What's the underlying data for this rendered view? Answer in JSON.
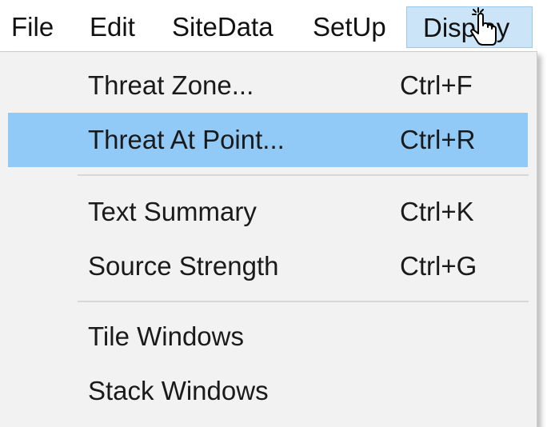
{
  "menubar": {
    "items": [
      {
        "label": "File"
      },
      {
        "label": "Edit"
      },
      {
        "label": "SiteData"
      },
      {
        "label": "SetUp"
      },
      {
        "label": "Display",
        "active": true
      }
    ]
  },
  "display_menu": {
    "items": [
      {
        "label": "Threat Zone...",
        "shortcut": "Ctrl+F"
      },
      {
        "label": "Threat At Point...",
        "shortcut": "Ctrl+R",
        "highlighted": true
      },
      {
        "label": "Text Summary",
        "shortcut": "Ctrl+K"
      },
      {
        "label": "Source Strength",
        "shortcut": "Ctrl+G"
      },
      {
        "label": "Tile Windows",
        "shortcut": ""
      },
      {
        "label": "Stack Windows",
        "shortcut": ""
      }
    ]
  },
  "colors": {
    "menubar_active_bg": "#cce4f7",
    "menu_highlight_bg": "#91c9f7",
    "menu_bg": "#f2f2f2"
  },
  "cursor": {
    "icon": "hand-pointer-cursor-icon"
  }
}
